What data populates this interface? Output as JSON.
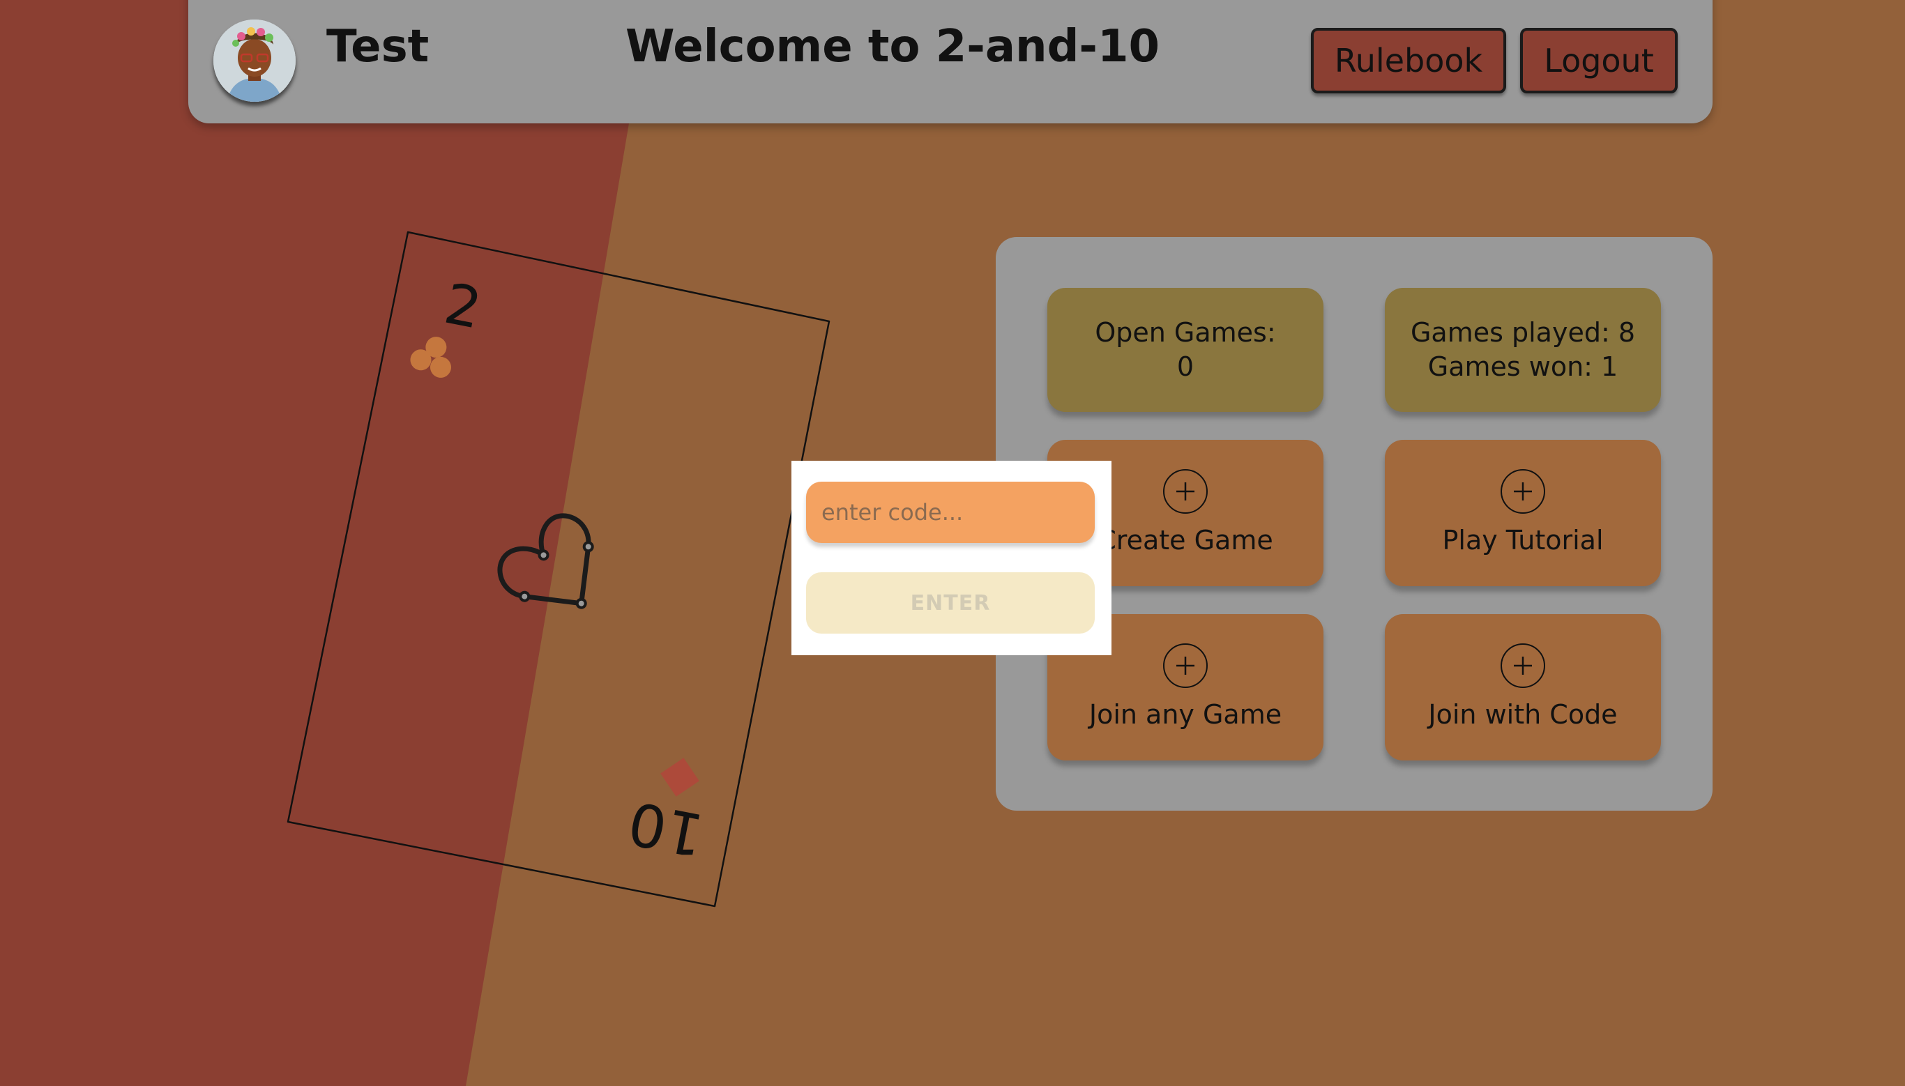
{
  "header": {
    "username": "Test",
    "title": "Welcome to 2-and-10",
    "rulebook_label": "Rulebook",
    "logout_label": "Logout"
  },
  "card": {
    "top_rank": "2",
    "bottom_rank": "10",
    "top_suit": "club-icon",
    "bottom_suit": "diamond-icon",
    "center_icon": "heart-outline-icon"
  },
  "stats": {
    "open_games_label": "Open Games:",
    "open_games_value": "0",
    "games_played": "Games played: 8",
    "games_won": "Games won: 1"
  },
  "actions": {
    "create_game": "Create Game",
    "play_tutorial": "Play Tutorial",
    "join_any_game": "Join any Game",
    "join_with_code": "Join with Code"
  },
  "modal": {
    "code_value": "",
    "code_placeholder": "enter code...",
    "enter_label": "ENTER"
  },
  "colors": {
    "background": "#93613a",
    "background_left": "#8b3f32",
    "header": "#999999",
    "stat_tile": "#8a763e",
    "action_tile": "#a2693c",
    "input": "#f4a261",
    "enter_button": "#f5e9c6"
  }
}
